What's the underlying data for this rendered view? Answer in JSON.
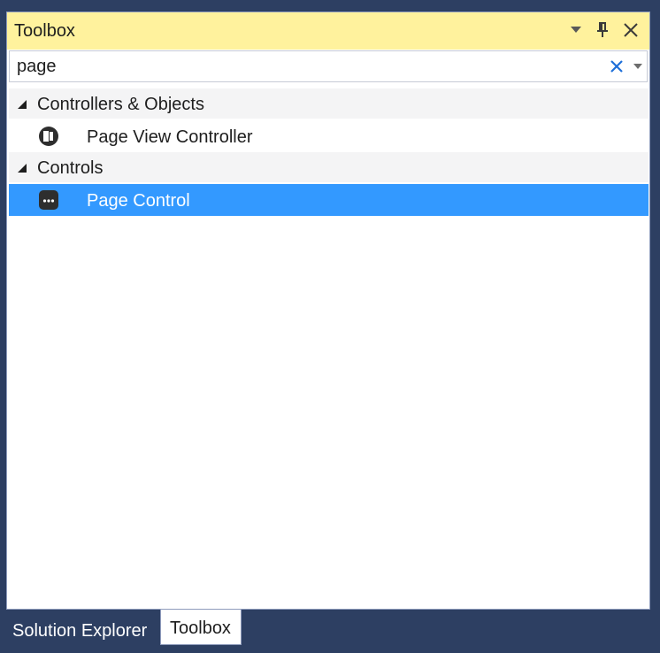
{
  "window": {
    "title": "Toolbox",
    "buttons": {
      "menu_icon": "chevron-down-icon",
      "pin_icon": "pin-icon",
      "close_icon": "close-icon"
    }
  },
  "search": {
    "value": "page",
    "clear_icon": "clear-icon",
    "dropdown_icon": "chevron-down-icon"
  },
  "groups": [
    {
      "label": "Controllers & Objects",
      "expanded": true,
      "items": [
        {
          "label": "Page View Controller",
          "icon": "page-view-controller-icon",
          "selected": false
        }
      ]
    },
    {
      "label": "Controls",
      "expanded": true,
      "items": [
        {
          "label": "Page Control",
          "icon": "page-control-icon",
          "selected": true
        }
      ]
    }
  ],
  "bottom_tabs": [
    {
      "label": "Solution Explorer",
      "active": false
    },
    {
      "label": "Toolbox",
      "active": true
    }
  ],
  "colors": {
    "background": "#2d3f62",
    "titlebar": "#fff29d",
    "selection": "#3399ff",
    "group_header": "#f4f4f5",
    "clear_icon": "#1e6fd9"
  }
}
